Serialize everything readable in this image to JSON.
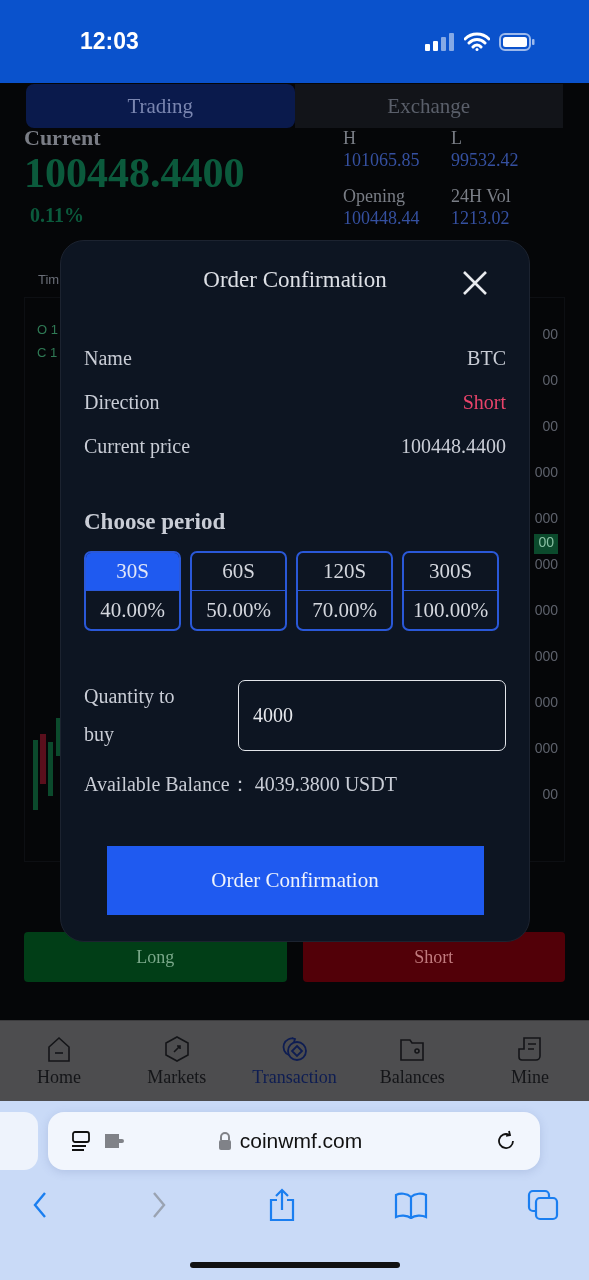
{
  "status_bar": {
    "time": "12:03"
  },
  "tabs": [
    {
      "label": "Trading",
      "selected": true
    },
    {
      "label": "Exchange",
      "selected": false
    }
  ],
  "ticker": {
    "current_label": "Current",
    "price": "100448.4400",
    "change": "0.11%",
    "stats": [
      {
        "label": "H",
        "value": "101065.85"
      },
      {
        "label": "L",
        "value": "99532.42"
      },
      {
        "label": "Opening",
        "value": "100448.44"
      },
      {
        "label": "24H Vol",
        "value": "1213.02"
      }
    ]
  },
  "chart": {
    "time_label": "Tim",
    "ohlc": [
      "O 1",
      "C 1"
    ],
    "axis_labels": [
      {
        "text": "00",
        "highlighted": false
      },
      {
        "text": "00",
        "highlighted": false
      },
      {
        "text": "00",
        "highlighted": false
      },
      {
        "text": "000",
        "highlighted": false
      },
      {
        "text": "000",
        "highlighted": false
      },
      {
        "text": "00",
        "highlighted": true
      },
      {
        "text": "000",
        "highlighted": false
      },
      {
        "text": "000",
        "highlighted": false
      },
      {
        "text": "000",
        "highlighted": false
      },
      {
        "text": "000",
        "highlighted": false
      },
      {
        "text": "000",
        "highlighted": false
      },
      {
        "text": "00",
        "highlighted": false
      }
    ]
  },
  "actions": [
    {
      "label": "Long",
      "kind": "long"
    },
    {
      "label": "Short",
      "kind": "short"
    }
  ],
  "bottom_nav": [
    {
      "label": "Home",
      "kind": "home",
      "selected": false
    },
    {
      "label": "Markets",
      "kind": "markets",
      "selected": false
    },
    {
      "label": "Transaction",
      "kind": "transaction",
      "selected": true
    },
    {
      "label": "Balances",
      "kind": "balances",
      "selected": false
    },
    {
      "label": "Mine",
      "kind": "mine",
      "selected": false
    }
  ],
  "browser": {
    "url": "coinwmf.com"
  },
  "modal": {
    "title": "Order Confirmation",
    "rows": [
      {
        "label": "Name",
        "value": "BTC",
        "color": "#c9cdd6"
      },
      {
        "label": "Direction",
        "value": "Short",
        "color": "#e8436a"
      },
      {
        "label": "Current price",
        "value": "100448.4400",
        "color": "#c9cdd6"
      }
    ],
    "period_title": "Choose period",
    "periods": [
      {
        "duration": "30S",
        "rate": "40.00%",
        "selected": true
      },
      {
        "duration": "60S",
        "rate": "50.00%",
        "selected": false
      },
      {
        "duration": "120S",
        "rate": "70.00%",
        "selected": false
      },
      {
        "duration": "300S",
        "rate": "100.00%",
        "selected": false
      }
    ],
    "quantity": {
      "label": "Quantity to buy",
      "value": "4000"
    },
    "balance": {
      "label": "Available Balance：",
      "value": "4039.3800 USDT"
    },
    "confirm_button": "Order Confirmation"
  }
}
